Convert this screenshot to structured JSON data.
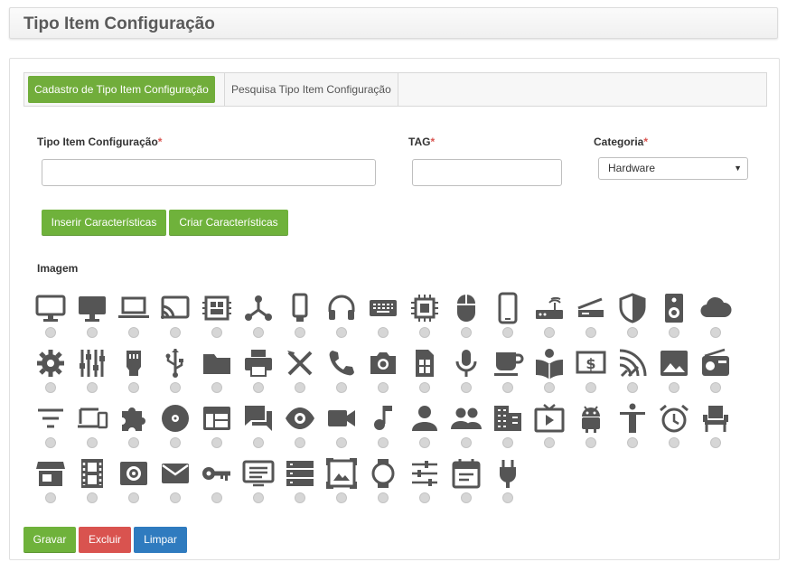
{
  "header": {
    "title": "Tipo Item Configuração"
  },
  "tabs": [
    {
      "label": "Cadastro de Tipo Item Configuração",
      "active": true
    },
    {
      "label": "Pesquisa Tipo Item Configuração",
      "active": false
    }
  ],
  "form": {
    "tipo_label": "Tipo Item Configuração",
    "tag_label": "TAG",
    "categoria_label": "Categoria",
    "required_mark": "*",
    "tipo_value": "",
    "tag_value": "",
    "categoria_value": "Hardware",
    "imagem_label": "Imagem"
  },
  "buttons": {
    "inserir": "Inserir Características",
    "criar": "Criar Características",
    "gravar": "Gravar",
    "excluir": "Excluir",
    "limpar": "Limpar"
  },
  "colors": {
    "primary_green": "#71ad3b",
    "danger": "#d9534f",
    "info_blue": "#2f7bbf",
    "icon_gray": "#555555"
  },
  "icons": [
    "desktop-icon",
    "monitor-icon",
    "laptop-icon",
    "cast-icon",
    "chip-board-icon",
    "network-icon",
    "phone-icon",
    "headphones-icon",
    "keyboard-icon",
    "cpu-icon",
    "mouse-icon",
    "smartphone-icon",
    "router-icon",
    "scanner-icon",
    "shield-icon",
    "speaker-icon",
    "cloud-icon",
    "gear-icon",
    "equalizer-icon",
    "ethernet-icon",
    "usb-icon",
    "folder-icon",
    "printer-icon",
    "utensils-icon",
    "telephone-icon",
    "camera-icon",
    "sim-card-icon",
    "microphone-icon",
    "coffee-icon",
    "reading-icon",
    "dollar-screen-icon",
    "wifi-tethering-icon",
    "image-icon",
    "radio-icon",
    "filter-icon",
    "devices-icon",
    "puzzle-icon",
    "disc-icon",
    "web-icon",
    "chat-icon",
    "eye-icon",
    "video-camera-icon",
    "music-note-icon",
    "person-icon",
    "people-icon",
    "building-icon",
    "tv-play-icon",
    "android-icon",
    "accessibility-icon",
    "alarm-icon",
    "chair-icon",
    "store-icon",
    "film-icon",
    "surround-icon",
    "mail-icon",
    "key-icon",
    "display-list-icon",
    "server-icon",
    "photo-frame-icon",
    "watch-icon",
    "sliders-icon",
    "calendar-icon",
    "plug-icon"
  ]
}
